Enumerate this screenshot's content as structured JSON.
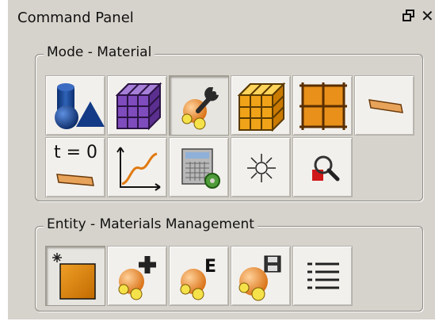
{
  "panel": {
    "title": "Command Panel"
  },
  "mode_group": {
    "legend": "Mode - Material",
    "buttons": [
      {
        "icon": "geometry-icon"
      },
      {
        "icon": "mesh-icon"
      },
      {
        "icon": "material-tool-icon",
        "pressed": true
      },
      {
        "icon": "hex-mesh-icon"
      },
      {
        "icon": "grid-icon"
      },
      {
        "icon": "strip-icon"
      },
      {
        "icon": "initial-condition-icon",
        "label": "t = 0"
      },
      {
        "icon": "curve-graph-icon"
      },
      {
        "icon": "calculator-gear-icon"
      },
      {
        "icon": "sun-icon"
      },
      {
        "icon": "magnifier-icon"
      }
    ]
  },
  "entity_group": {
    "legend": "Entity - Materials Management",
    "buttons": [
      {
        "icon": "new-material-icon",
        "pressed": true
      },
      {
        "icon": "add-material-icon"
      },
      {
        "icon": "edit-material-icon",
        "badge": "E"
      },
      {
        "icon": "save-material-icon"
      },
      {
        "icon": "list-icon"
      }
    ]
  }
}
